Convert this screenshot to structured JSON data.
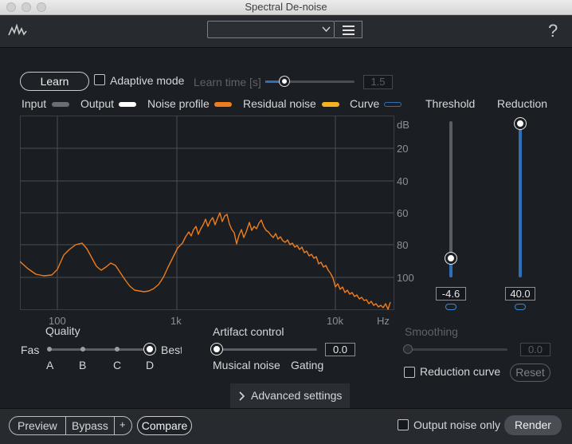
{
  "window": {
    "title": "Spectral De-noise"
  },
  "header": {
    "preset_value": "",
    "help_symbol": "?"
  },
  "learn": {
    "button_label": "Learn",
    "adaptive_label": "Adaptive mode",
    "adaptive_checked": false,
    "learn_time_label": "Learn time [s]",
    "learn_time_value": "1.5"
  },
  "legend": [
    {
      "label": "Input",
      "color": "#6b6f75"
    },
    {
      "label": "Output",
      "color": "#ffffff"
    },
    {
      "label": "Noise profile",
      "color": "#f07d1c"
    },
    {
      "label": "Residual noise",
      "color": "#f5b21e"
    },
    {
      "label": "Curve",
      "color": "#2f6fb8"
    }
  ],
  "graph": {
    "db_labels": [
      "dB",
      "20",
      "40",
      "60",
      "80",
      "100"
    ],
    "freq_labels": [
      "100",
      "1k",
      "10k",
      "Hz"
    ]
  },
  "threshold": {
    "label": "Threshold",
    "value": "-4.6",
    "level": 0.12
  },
  "reduction": {
    "label": "Reduction",
    "value": "40.0",
    "level": 1.0
  },
  "quality": {
    "label": "Quality",
    "left": "Fas",
    "right": "Best",
    "steps": [
      "A",
      "B",
      "C",
      "D"
    ],
    "selected": "D"
  },
  "artifact": {
    "label": "Artifact control",
    "value": "0.0",
    "left": "Musical noise",
    "right": "Gating"
  },
  "smoothing": {
    "label": "Smoothing",
    "value": "0.0"
  },
  "reduction_curve": {
    "label": "Reduction curve",
    "checked": false,
    "reset_label": "Reset"
  },
  "advanced": {
    "label": "Advanced settings"
  },
  "footer": {
    "preview": "Preview",
    "bypass": "Bypass",
    "plus": "+",
    "compare": "Compare",
    "output_noise_only": "Output noise only",
    "render": "Render"
  },
  "colors": {
    "accent": "#2f6fb8",
    "noise_profile": "#f07d1c"
  }
}
